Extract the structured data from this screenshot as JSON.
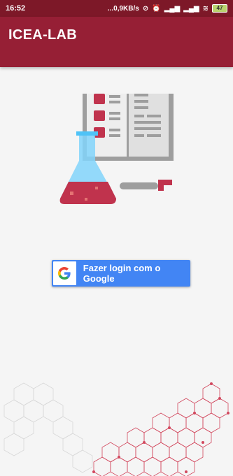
{
  "status_bar": {
    "time": "16:52",
    "network": "...0,9KB/s",
    "icons": [
      "mute-icon",
      "alarm-icon",
      "signal-icon",
      "signal-icon",
      "wifi-icon",
      "battery-icon"
    ],
    "battery": "47"
  },
  "app_bar": {
    "title": "ICEA-LAB"
  },
  "login": {
    "google_button_label": "Fazer login com o Google",
    "icon": "google-g-icon"
  },
  "colors": {
    "app_bar": "#961f35",
    "status_bar": "#7d1828",
    "google_button": "#4285f4",
    "background": "#f5f5f5"
  }
}
